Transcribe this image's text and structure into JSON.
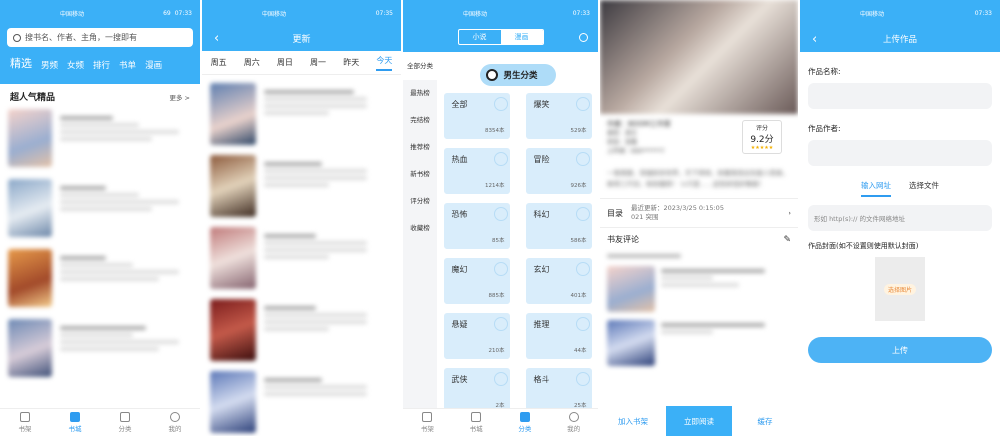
{
  "status": {
    "carrier": "中国移动",
    "net": "4G",
    "battery": "69",
    "time1": "07:33",
    "time2": "07:35",
    "time3": "07:33",
    "time5": "07:33"
  },
  "s1": {
    "search_placeholder": "搜书名、作者、主角，一搜即有",
    "tabs": [
      "精选",
      "男频",
      "女频",
      "排行",
      "书单",
      "漫画"
    ],
    "section_title": "超人气精品",
    "more": "更多"
  },
  "s2": {
    "title": "更新",
    "days": [
      "周五",
      "周六",
      "周日",
      "周一",
      "昨天",
      "今天"
    ]
  },
  "s3": {
    "seg": [
      "小说",
      "漫画"
    ],
    "side": [
      "全部分类",
      "最热榜",
      "完结榜",
      "推荐榜",
      "新书榜",
      "评分榜",
      "收藏榜"
    ],
    "banner": "男生分类",
    "cats": [
      {
        "name": "全部",
        "count": "8354本"
      },
      {
        "name": "爆笑",
        "count": "529本"
      },
      {
        "name": "热血",
        "count": "1214本"
      },
      {
        "name": "冒险",
        "count": "926本"
      },
      {
        "name": "恐怖",
        "count": "85本"
      },
      {
        "name": "科幻",
        "count": "586本"
      },
      {
        "name": "魔幻",
        "count": "885本"
      },
      {
        "name": "玄幻",
        "count": "401本"
      },
      {
        "name": "悬疑",
        "count": "210本"
      },
      {
        "name": "推理",
        "count": "44本"
      },
      {
        "name": "武侠",
        "count": "2本"
      },
      {
        "name": "格斗",
        "count": "25本"
      }
    ]
  },
  "s4": {
    "author": "作者：BOOM工作室",
    "type": "类型：其它",
    "state": "状态：连载",
    "uploader": "上传者：K90******7",
    "score_label": "评分",
    "score": "9.2分",
    "desc": "一卷摇捷，穿越妖异世界，天下将倾，妖魔鬼怪出生敌人而食，故将三尺剑，斩妖魔邪！ \\n只是……这些妖怪好像跟！",
    "toc": "目录",
    "update_line1": "最近更新：2023/3/25 0:15:05",
    "update_line2": "021 突围",
    "review": "书友评论",
    "btn_shelf": "加入书架",
    "btn_read": "立即阅读",
    "btn_cache": "缓存"
  },
  "s5": {
    "title": "上传作品",
    "name_label": "作品名称:",
    "author_label": "作品作者:",
    "tab_url": "输入网址",
    "tab_file": "选择文件",
    "url_placeholder": "形如 http(s):// 的文件网络地址",
    "cover_label": "作品封面(如不设置则使用默认封面)",
    "cover_btn": "选择图片",
    "submit": "上传"
  },
  "nav1": [
    "书架",
    "书城",
    "分类",
    "我的"
  ],
  "nav3": [
    "书架",
    "书城",
    "分类",
    "我的"
  ],
  "colors": {
    "accent": "#3bb0f7",
    "button": "#4db3f5",
    "card": "#d9edfb"
  }
}
